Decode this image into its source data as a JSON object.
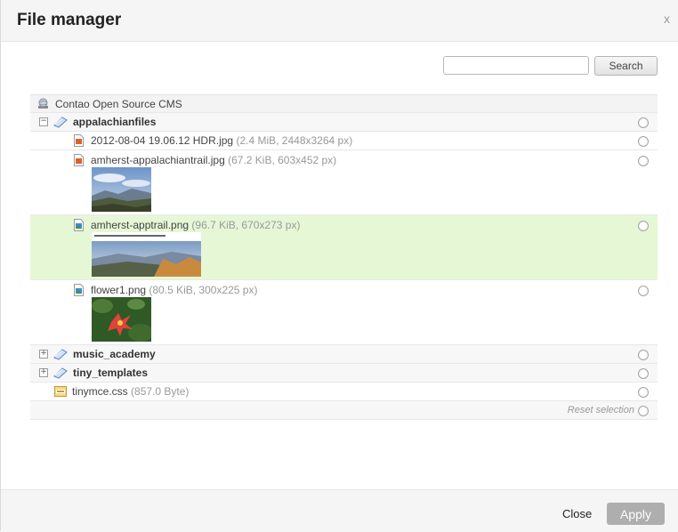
{
  "dialog": {
    "title": "File manager",
    "close_x": "x"
  },
  "search": {
    "value": "",
    "placeholder": "",
    "button_label": "Search"
  },
  "tree": {
    "root_label": "Contao Open Source CMS",
    "folders": [
      {
        "name": "appalachianfiles",
        "expanded": true,
        "files": [
          {
            "name": "2012-08-04 19.06.12 HDR.jpg",
            "meta": "(2.4 MiB, 2448x3264 px)",
            "thumb": false
          },
          {
            "name": "amherst-appalachiantrail.jpg",
            "meta": "(67.2 KiB, 603x452 px)",
            "thumb": true
          },
          {
            "name": "amherst-apptrail.png",
            "meta": "(96.7 KiB, 670x273 px)",
            "thumb": true,
            "selected": true
          },
          {
            "name": "flower1.png",
            "meta": "(80.5 KiB, 300x225 px)",
            "thumb": true
          }
        ]
      },
      {
        "name": "music_academy",
        "expanded": false
      },
      {
        "name": "tiny_templates",
        "expanded": false
      }
    ],
    "root_file": {
      "name": "tinymce.css",
      "meta": "(857.0 Byte)"
    },
    "reset_label": "Reset selection"
  },
  "footer": {
    "close_label": "Close",
    "apply_label": "Apply"
  },
  "colors": {
    "selected_row": "#e6f7d6",
    "apply_button": "#aeaeae"
  },
  "icons": {
    "root": "globe-icon",
    "folder": "folder-icon",
    "jpg": "image-file-icon",
    "png": "png-file-icon",
    "css": "css-file-icon"
  }
}
